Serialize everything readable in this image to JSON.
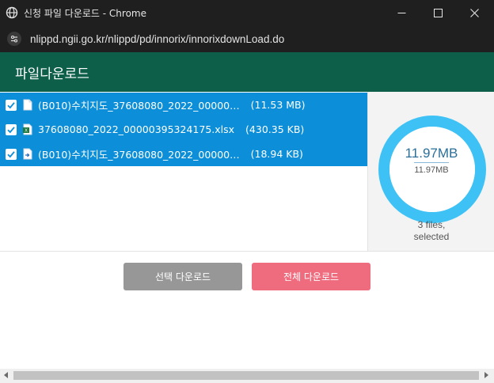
{
  "window": {
    "title": "신청 파일 다운로드 - Chrome"
  },
  "address_bar": {
    "url": "nlippd.ngii.go.kr/nlippd/pd/innorix/innorixdownLoad.do"
  },
  "page": {
    "heading": "파일다운로드"
  },
  "files": [
    {
      "name": "(B010)수치지도_37608080_2022_00000…",
      "size": "(11.53 MB)",
      "icon": "document-icon",
      "checked": true
    },
    {
      "name": "37608080_2022_00000395324175.xlsx",
      "size": "(430.35 KB)",
      "icon": "excel-file-icon",
      "checked": true
    },
    {
      "name": "(B010)수치지도_37608080_2022_00000…",
      "size": "(18.94 KB)",
      "icon": "shortcut-file-icon",
      "checked": true
    }
  ],
  "summary": {
    "total_size": "11.97MB",
    "selected_size": "11.97MB",
    "count_line1": "3 files,",
    "count_line2": "selected",
    "progress_fraction": 1.0
  },
  "buttons": {
    "selected_download": "선택 다운로드",
    "all_download": "전체 다운로드"
  },
  "colors": {
    "header_bg": "#0d5f4a",
    "row_selected": "#0c8fd8",
    "donut": "#3ec2f5",
    "selected_btn": "#979797",
    "all_btn": "#ef6b7e"
  }
}
